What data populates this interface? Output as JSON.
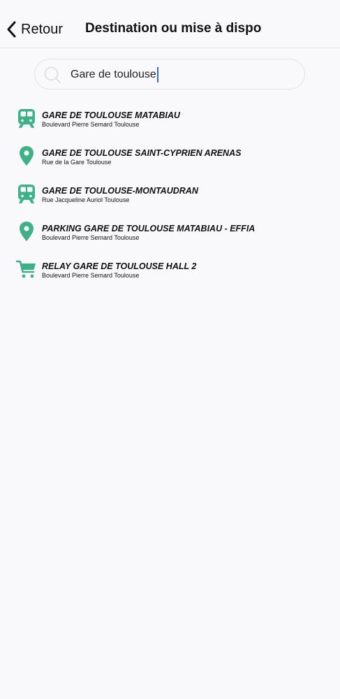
{
  "header": {
    "back_label": "Retour",
    "title": "Destination ou mise à dispo"
  },
  "search": {
    "value": "Gare de toulouse"
  },
  "colors": {
    "accent": "#3fb186",
    "caret": "#2f6fd1"
  },
  "results": [
    {
      "icon": "train-icon",
      "title": "GARE DE TOULOUSE MATABIAU",
      "subtitle": "Boulevard Pierre Semard Toulouse"
    },
    {
      "icon": "map-pin-icon",
      "title": "GARE DE TOULOUSE SAINT-CYPRIEN ARENAS",
      "subtitle": "Rue de la Gare Toulouse"
    },
    {
      "icon": "train-icon",
      "title": "GARE DE TOULOUSE-MONTAUDRAN",
      "subtitle": "Rue Jacqueline Auriol Toulouse"
    },
    {
      "icon": "map-pin-icon",
      "title": "PARKING GARE DE TOULOUSE MATABIAU - EFFIA",
      "subtitle": "Boulevard Pierre Semard Toulouse"
    },
    {
      "icon": "shopping-cart-icon",
      "title": "RELAY GARE DE TOULOUSE HALL 2",
      "subtitle": "Boulevard Pierre Semard Toulouse"
    }
  ]
}
